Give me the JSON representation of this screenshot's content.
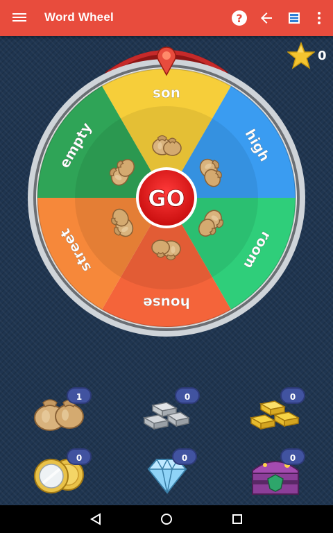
{
  "app": {
    "title": "Word Wheel"
  },
  "toolbar": {
    "menu_icon": "hamburger-menu-icon",
    "help_icon": "help-circle-icon",
    "back_icon": "arrow-back-icon",
    "list_icon": "list-icon",
    "more_icon": "more-vert-icon",
    "help_glyph": "?"
  },
  "score": {
    "value": "0",
    "icon": "star-icon"
  },
  "wheel": {
    "button_label": "GO",
    "segments": [
      {
        "word": "son",
        "color": "#f6ce3a"
      },
      {
        "word": "high",
        "color": "#3a9cf1"
      },
      {
        "word": "room",
        "color": "#2fce7a"
      },
      {
        "word": "house",
        "color": "#f4643a"
      },
      {
        "word": "street",
        "color": "#f6883a"
      },
      {
        "word": "empty",
        "color": "#2fa457"
      }
    ],
    "prize_icon": "money-bag-icon",
    "pointer_icon": "map-pin-icon"
  },
  "inventory": [
    {
      "name": "money-bags",
      "icon": "money-bags-icon",
      "count": "1"
    },
    {
      "name": "silver-bars",
      "icon": "silver-bars-icon",
      "count": "0"
    },
    {
      "name": "gold-bars",
      "icon": "gold-bars-icon",
      "count": "0"
    },
    {
      "name": "coins",
      "icon": "coins-icon",
      "count": "0"
    },
    {
      "name": "diamond",
      "icon": "diamond-icon",
      "count": "0"
    },
    {
      "name": "treasure-chest",
      "icon": "treasure-chest-icon",
      "count": "0"
    }
  ],
  "navbar": {
    "back_icon": "nav-back-icon",
    "home_icon": "nav-home-icon",
    "recents_icon": "nav-recents-icon"
  }
}
